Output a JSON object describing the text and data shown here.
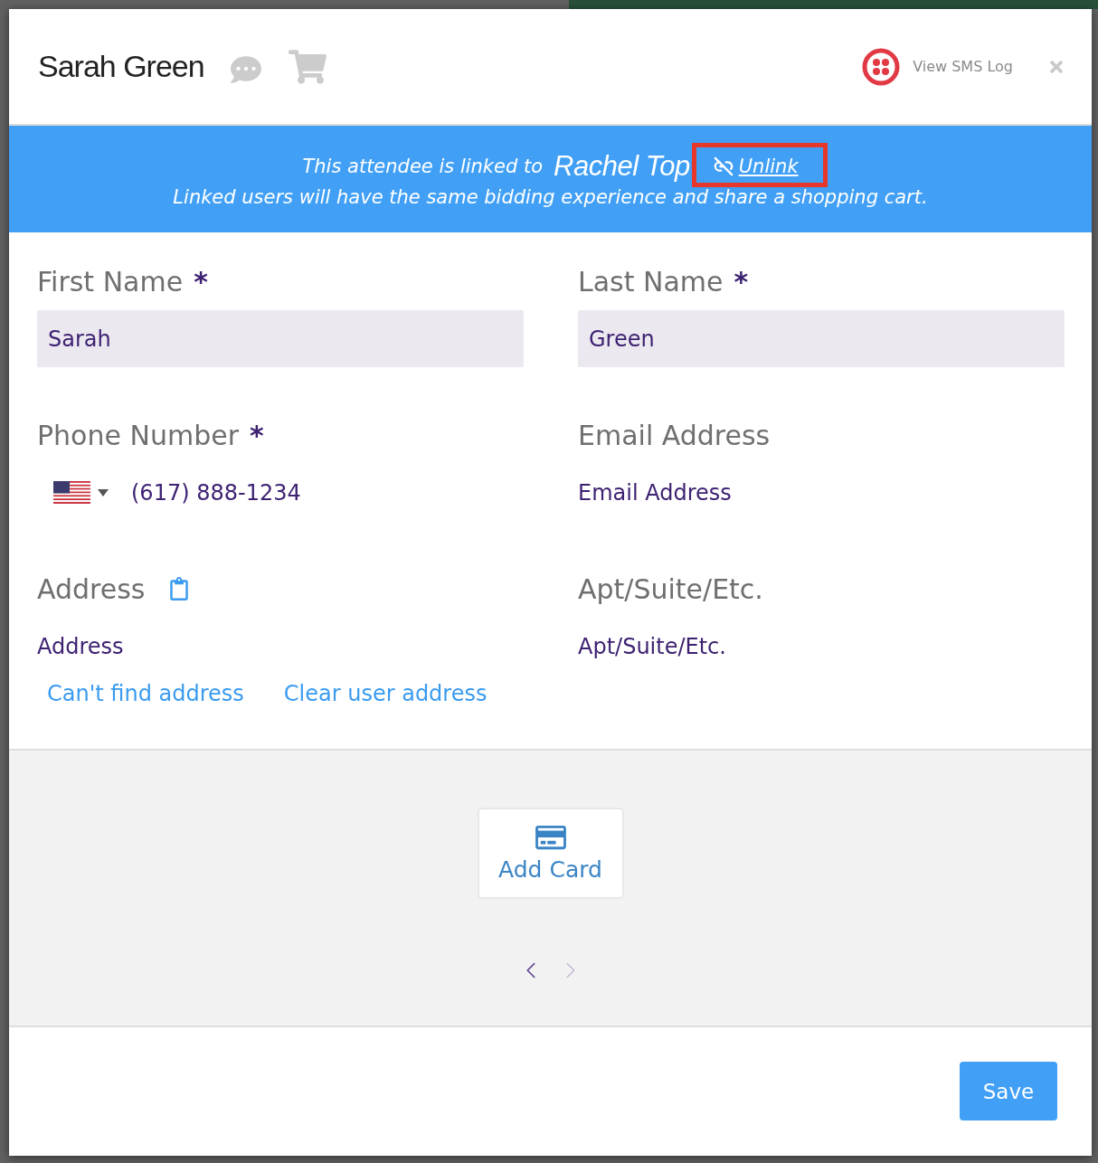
{
  "header": {
    "title": "Sarah Green",
    "sms_log": "View SMS Log"
  },
  "banner": {
    "prefix": "This attendee is linked to",
    "linked_name": "Rachel Top",
    "unlink": {
      "label": "Unlink",
      "highlighted": true
    },
    "note": "Linked users will have the same bidding experience and share a shopping cart."
  },
  "form": {
    "fields": [
      {
        "kind": "boxed",
        "label": "First Name",
        "required_mark": "*",
        "value": "Sarah"
      },
      {
        "kind": "boxed",
        "label": "Last Name",
        "required_mark": "*",
        "value": "Green"
      },
      {
        "kind": "phone",
        "label": "Phone Number",
        "required_mark": "*",
        "value": "(617) 888-1234"
      },
      {
        "kind": "plain",
        "label": "Email Address",
        "placeholder": "Email Address"
      },
      {
        "kind": "address",
        "label": "Address",
        "placeholder": "Address",
        "links": [
          "Can't find address",
          "Clear user address"
        ]
      },
      {
        "kind": "plain",
        "label": "Apt/Suite/Etc.",
        "placeholder": "Apt/Suite/Etc."
      }
    ]
  },
  "cards": {
    "add_card": "Add Card",
    "pager": [
      {
        "kind": "previous",
        "disabled": false
      },
      {
        "kind": "next",
        "disabled": true
      }
    ]
  },
  "footer": {
    "save": "Save"
  }
}
